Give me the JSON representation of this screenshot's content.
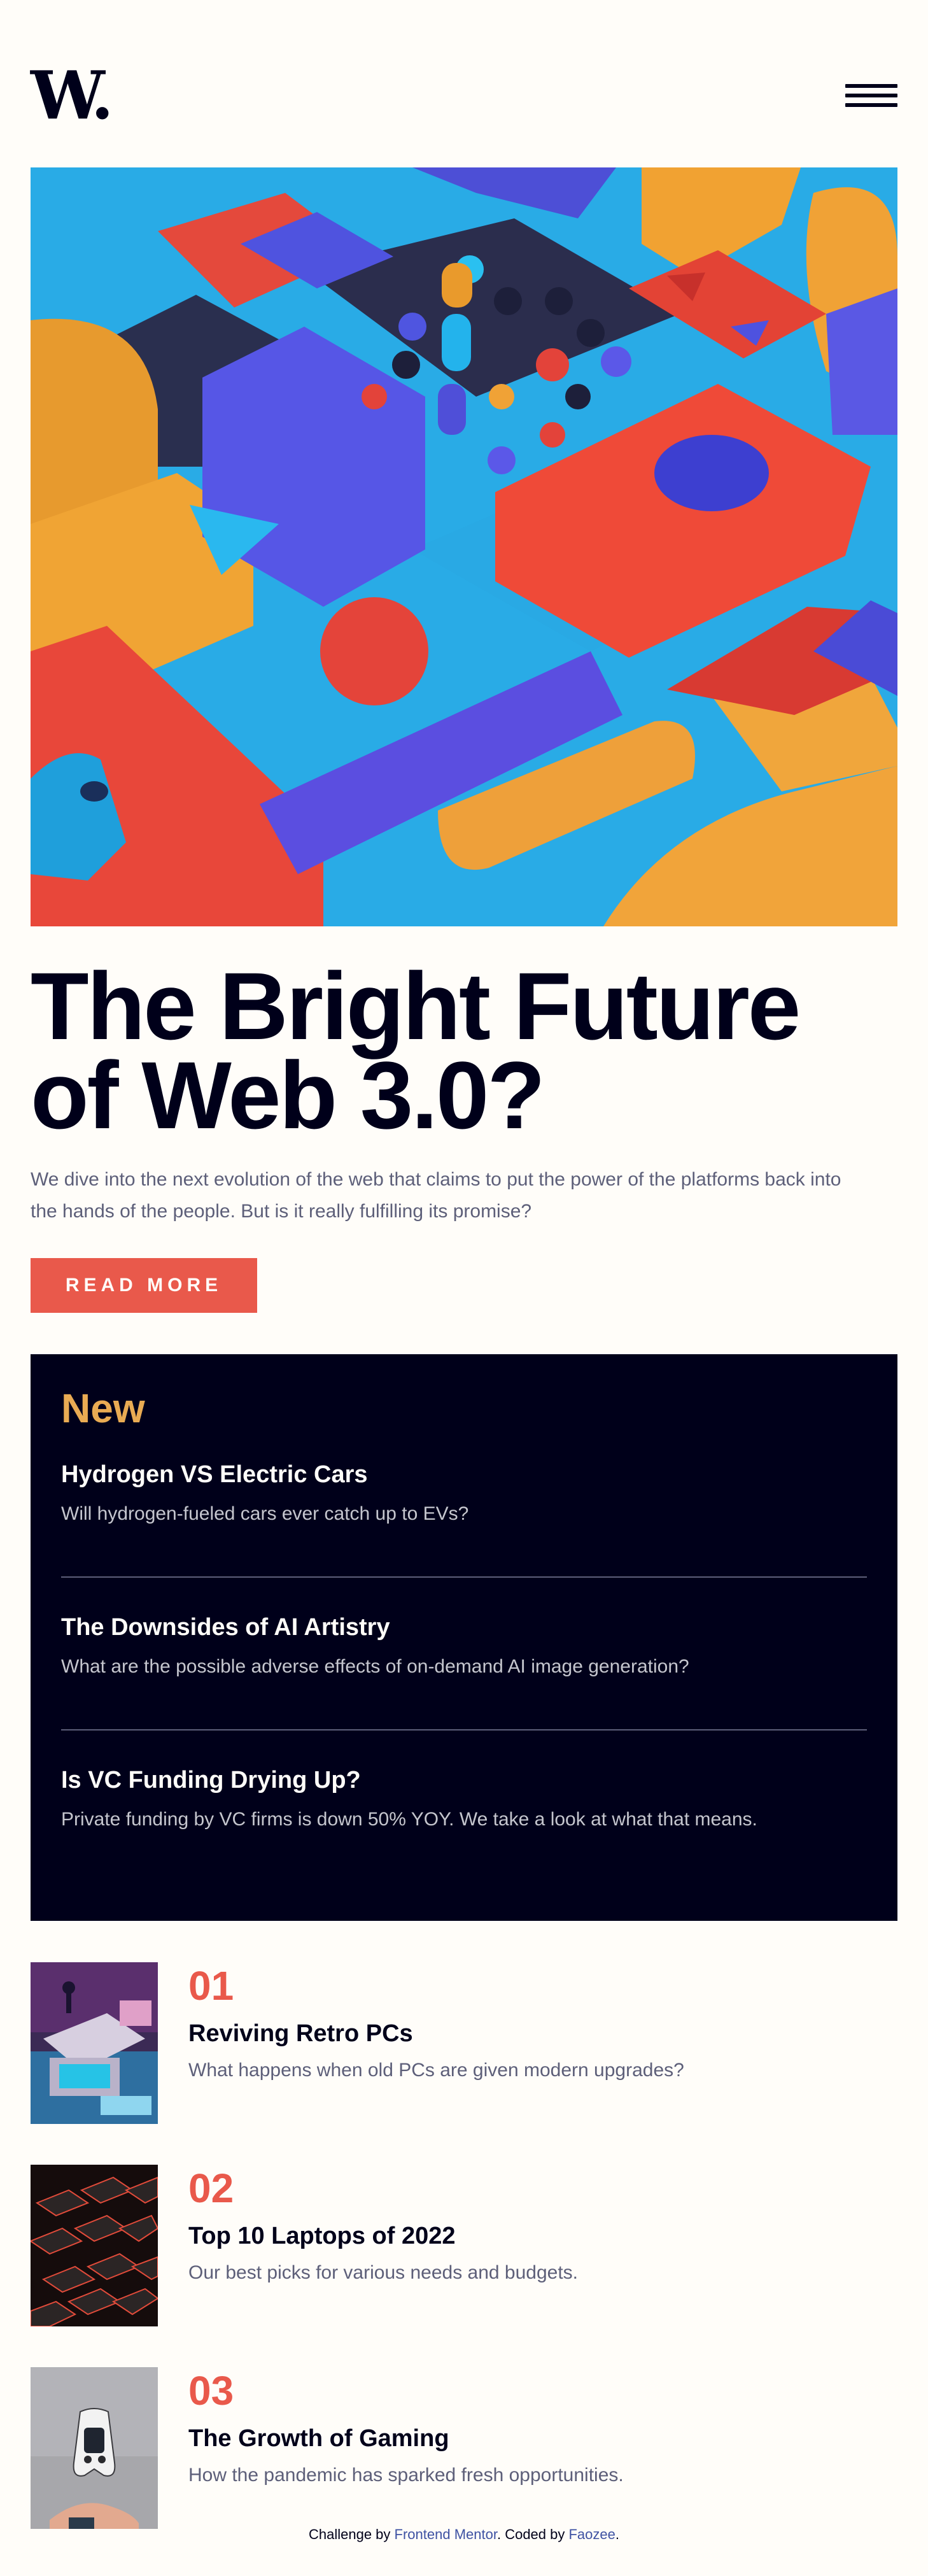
{
  "header": {
    "logo": "W.",
    "menu_icon": "hamburger-menu-icon"
  },
  "hero": {
    "image_alt_icon": "abstract-3d-blocks-image",
    "title": "The Bright Future of Web 3.0?",
    "description": "We dive into the next evolution of the web that claims to put the power of the platforms back into the hands of the people. But is it really fulfilling its promise?",
    "button_label": "READ MORE"
  },
  "new_panel": {
    "heading": "New",
    "items": [
      {
        "title": "Hydrogen VS Electric Cars",
        "description": "Will hydrogen-fueled cars ever catch up to EVs?"
      },
      {
        "title": "The Downsides of AI Artistry",
        "description": "What are the possible adverse effects of on-demand AI image generation?"
      },
      {
        "title": "Is VC Funding Drying Up?",
        "description": "Private funding by VC firms is down 50% YOY. We take a look at what that means."
      }
    ]
  },
  "articles": [
    {
      "number": "01",
      "title": "Reviving Retro PCs",
      "description": "What happens when old PCs are given modern upgrades?",
      "thumb_icon": "retro-pc-image"
    },
    {
      "number": "02",
      "title": "Top 10 Laptops of 2022",
      "description": "Our best picks for various needs and budgets.",
      "thumb_icon": "laptop-keyboard-image"
    },
    {
      "number": "03",
      "title": "The Growth of Gaming",
      "description": "How the pandemic has sparked fresh opportunities.",
      "thumb_icon": "game-controller-image"
    }
  ],
  "footer": {
    "prefix": "Challenge by ",
    "challenge_link": "Frontend Mentor",
    "middle": ". Coded by ",
    "author_link": "Faozee",
    "suffix": "."
  },
  "colors": {
    "background": "#fffdf9",
    "dark": "#00001a",
    "accent_red": "#e9594b",
    "accent_orange": "#e9ab53",
    "grey_text": "#5d5f79",
    "link_blue": "#3e52a3"
  }
}
